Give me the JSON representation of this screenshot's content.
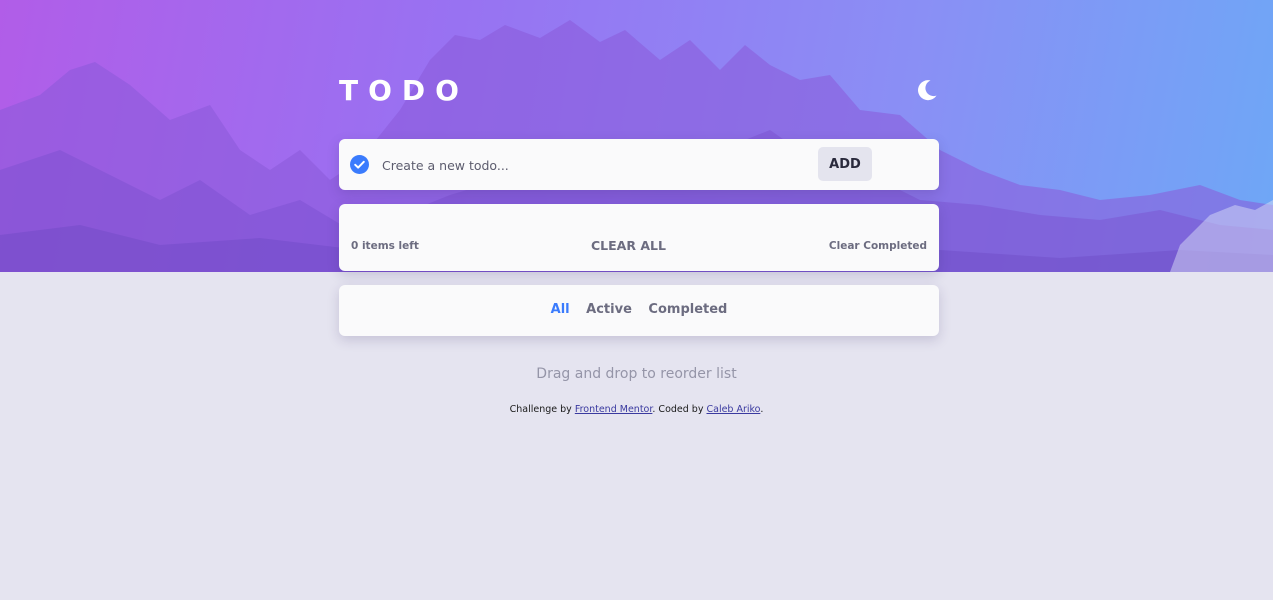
{
  "header": {
    "title": "TODO",
    "theme_icon": "moon-icon"
  },
  "new_todo": {
    "check_icon": "checkmark-circle-icon",
    "placeholder": "Create a new todo...",
    "value": "",
    "add_label": "ADD"
  },
  "list": {
    "items": [],
    "items_left": "0 items left",
    "clear_all_label": "CLEAR ALL",
    "clear_completed_label": "Clear Completed"
  },
  "filters": {
    "all": "All",
    "active": "Active",
    "completed": "Completed",
    "selected": "All"
  },
  "hint": "Drag and drop to reorder list",
  "attribution": {
    "prefix": "Challenge by ",
    "link1": "Frontend Mentor",
    "middle": ". Coded by ",
    "link2": "Caleb Ariko",
    "suffix": "."
  },
  "colors": {
    "accent": "#3a7bfd",
    "background": "#e5e4f0",
    "card": "#fafafb",
    "hero_start": "#b15de8",
    "hero_end": "#6ea7f6"
  }
}
